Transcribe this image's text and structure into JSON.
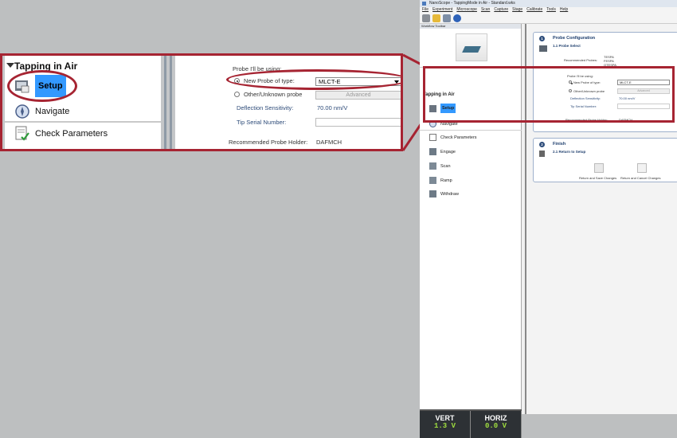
{
  "app": {
    "title": "NanoScope - TappingMode in Air - Standard.wks",
    "menu": [
      "File",
      "Experiment",
      "Microscope",
      "Scan",
      "Capture",
      "Stage",
      "Calibrate",
      "Tools",
      "Help"
    ],
    "workflow_toolbar_title": "Workflow Toolbar",
    "workflow_header": "Tapping in Air",
    "workflow_items": [
      "Setup",
      "Navigate",
      "Check Parameters",
      "Engage",
      "Scan",
      "Ramp",
      "Withdraw"
    ],
    "readout": {
      "vert_label": "VERT",
      "vert_value": "1.3 V",
      "horiz_label": "HORIZ",
      "horiz_value": "0.0 V"
    }
  },
  "probe_config": {
    "number": "1",
    "title": "Probe Configuration",
    "subtitle": "1.1 Probe Select",
    "recommended_probes_label": "Recommended Probes:",
    "recommended_probes": [
      "TESPA",
      "FESPA",
      "OTESPA"
    ],
    "probe_using_label": "Probe I'll be using:",
    "new_probe_label": "New Probe of type:",
    "probe_type_value": "MLCT-E",
    "other_probe_label": "Other/Unknown probe",
    "advanced_label": "Advanced",
    "deflection_label": "Deflection Sensitivity:",
    "deflection_value": "70.00 nm/V",
    "tip_serial_label": "Tip Serial Number:",
    "holder_label": "Recommended Probe Holder:",
    "holder_value": "DAFMCH"
  },
  "finish": {
    "number": "2",
    "title": "Finish",
    "subtitle": "2.1 Return to Setup",
    "save_label": "Return and Save Changes",
    "cancel_label": "Return and Cancel Changes"
  },
  "colors": {
    "highlight": "#a62432",
    "selected": "#3399ff",
    "readout_value": "#9fdd3f"
  }
}
